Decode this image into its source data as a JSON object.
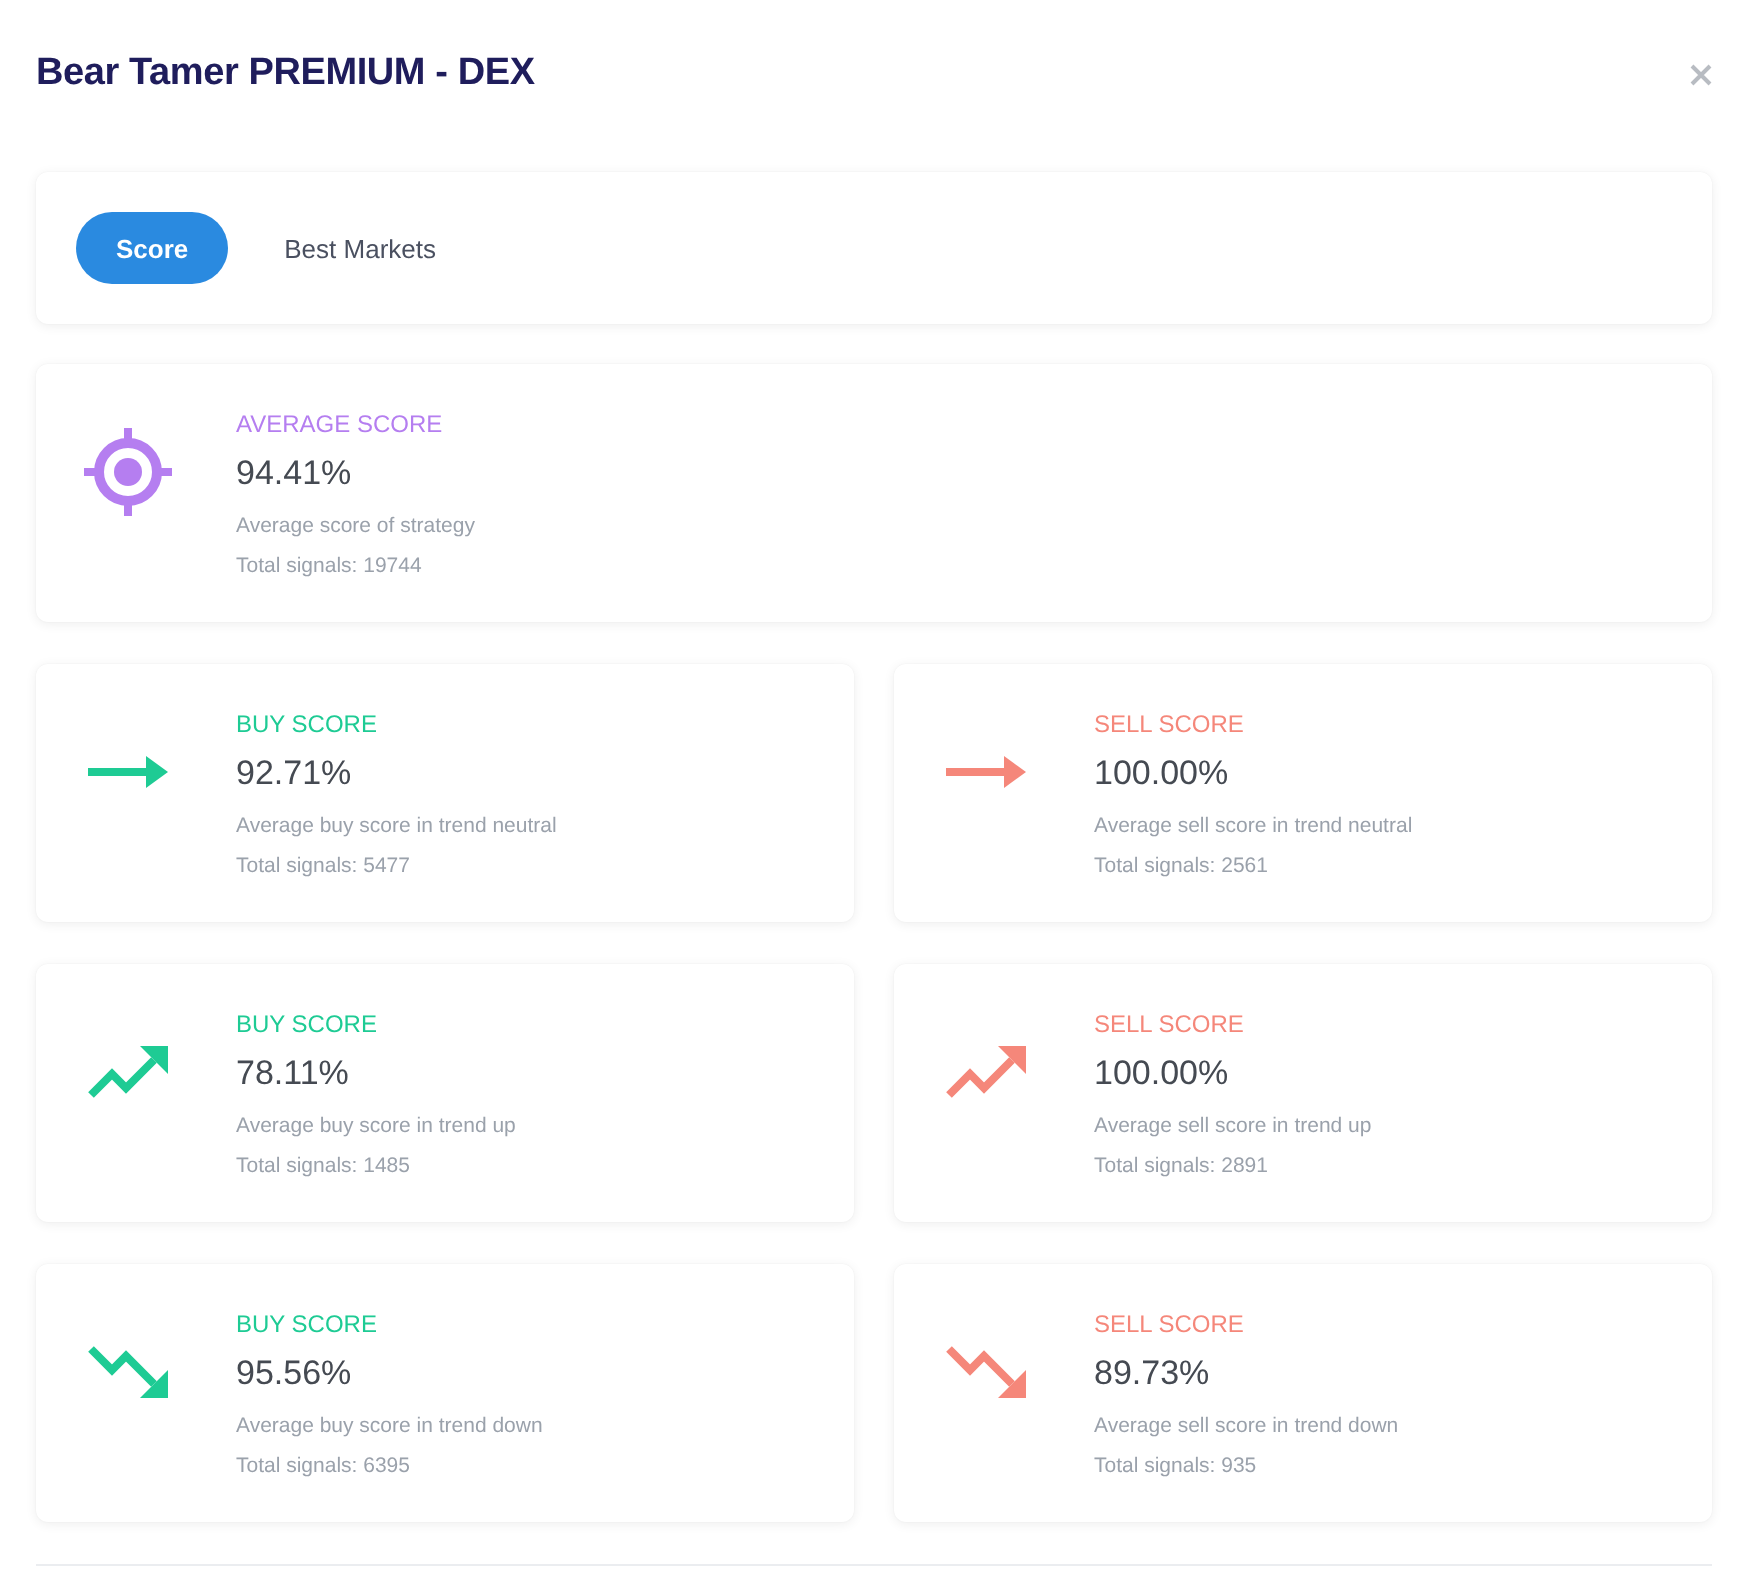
{
  "window": {
    "title": "Bear Tamer PREMIUM - DEX"
  },
  "tabs": [
    {
      "label": "Score",
      "selected": true
    },
    {
      "label": "Best Markets",
      "selected": false
    }
  ],
  "summary": {
    "kind": "target",
    "color": "#b57ef0",
    "label": "AVERAGE SCORE",
    "value": "94.41%",
    "description": "Average score of strategy",
    "total": "Total signals: 19744"
  },
  "score_cards": [
    {
      "kind": "flat",
      "color": "#1ecb94",
      "label": "BUY SCORE",
      "value": "92.71%",
      "description": "Average buy score in trend neutral",
      "total": "Total signals: 5477"
    },
    {
      "kind": "flat",
      "color": "#f5877a",
      "label": "SELL SCORE",
      "value": "100.00%",
      "description": "Average sell score in trend neutral",
      "total": "Total signals: 2561"
    },
    {
      "kind": "up",
      "color": "#1ecb94",
      "label": "BUY SCORE",
      "value": "78.11%",
      "description": "Average buy score in trend up",
      "total": "Total signals: 1485"
    },
    {
      "kind": "up",
      "color": "#f5877a",
      "label": "SELL SCORE",
      "value": "100.00%",
      "description": "Average sell score in trend up",
      "total": "Total signals: 2891"
    },
    {
      "kind": "down",
      "color": "#1ecb94",
      "label": "BUY SCORE",
      "value": "95.56%",
      "description": "Average buy score in trend down",
      "total": "Total signals: 6395"
    },
    {
      "kind": "down",
      "color": "#f5877a",
      "label": "SELL SCORE",
      "value": "89.73%",
      "description": "Average sell score in trend down",
      "total": "Total signals: 935"
    }
  ]
}
